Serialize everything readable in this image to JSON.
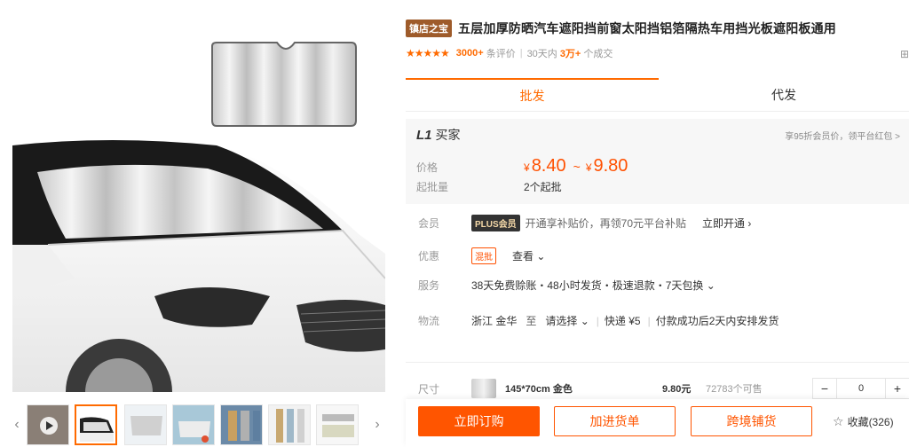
{
  "product": {
    "shop_badge": "镇店之宝",
    "title": "五层加厚防晒汽车遮阳挡前窗太阳挡铝箔隔热车用挡光板遮阳板通用",
    "stars": "★★★★★",
    "reviews_count": "3000+",
    "reviews_label": "条评价",
    "sales_period": "30天内",
    "sales_count": "3万+",
    "sales_label": "个成交"
  },
  "tabs": {
    "wholesale": "批发",
    "dropship": "代发"
  },
  "buyer": {
    "level": "L1",
    "label": "买家",
    "member_link": "享95折会员价，领平台红包 >"
  },
  "price": {
    "label": "价格",
    "currency": "¥",
    "low": "8.40",
    "tilde": "~",
    "high": "9.80",
    "moq_label": "起批量",
    "moq_value": "2个起批"
  },
  "attributes": {
    "member_label": "会员",
    "plus_badge": "PLUS会员",
    "plus_text": "开通享补贴价，再领70元平台补贴",
    "plus_link": "立即开通 ›",
    "discount_label": "优惠",
    "discount_tag": "混批",
    "discount_link": "查看 ⌄",
    "service_label": "服务",
    "service_text": "38天免费赊账・48小时发货・极速退款・7天包换 ⌄",
    "logistics_label": "物流",
    "origin": "浙江 金华",
    "to": "至",
    "destination": "请选择 ⌄",
    "shipping": "快递 ¥5",
    "ship_note": "付款成功后2天内安排发货"
  },
  "sku": {
    "label": "尺寸",
    "name": "145*70cm 金色",
    "price": "9.80元",
    "stock": "72783个可售",
    "minus": "−",
    "qty": "0",
    "plus": "+"
  },
  "actions": {
    "buy": "立即订购",
    "add_cart": "加进货单",
    "cross_border": "跨境铺货",
    "favorite": "收藏(326)"
  }
}
